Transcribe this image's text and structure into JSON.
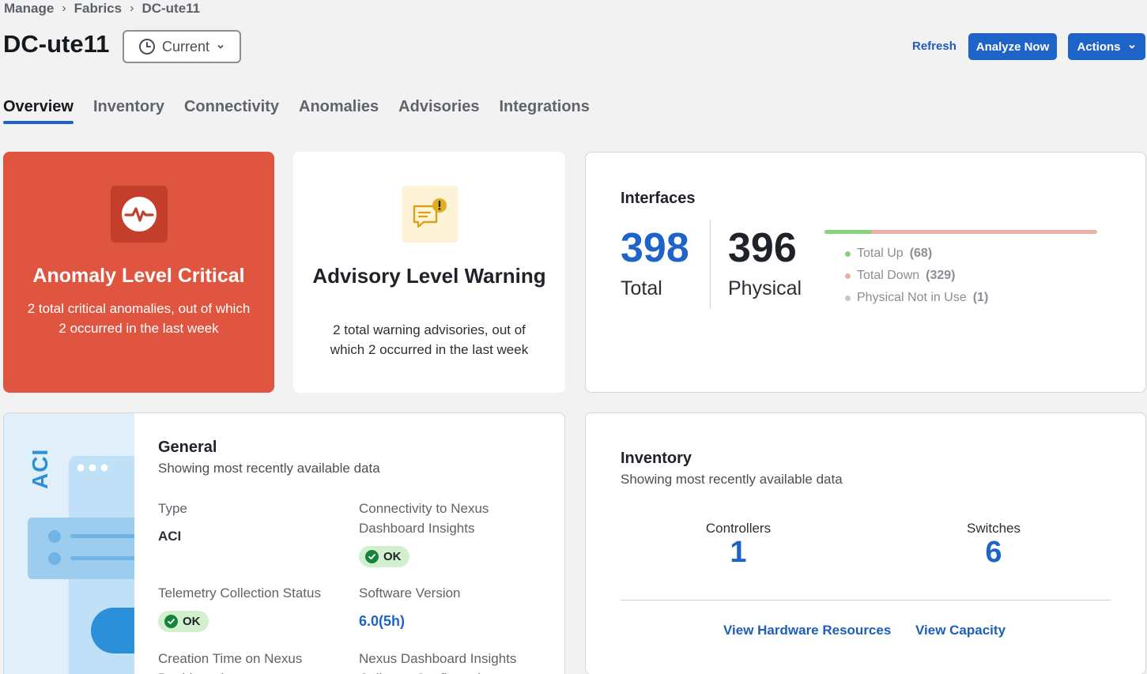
{
  "breadcrumb": {
    "items": [
      "Manage",
      "Fabrics",
      "DC-ute11"
    ]
  },
  "header": {
    "title": "DC-ute11",
    "time_selector": "Current",
    "refresh_label": "Refresh",
    "analyze_label": "Analyze Now",
    "actions_label": "Actions"
  },
  "tabs": [
    "Overview",
    "Inventory",
    "Connectivity",
    "Anomalies",
    "Advisories",
    "Integrations"
  ],
  "anomaly_card": {
    "title": "Anomaly Level Critical",
    "description": "2 total critical anomalies, out of which 2 occurred in the last week",
    "icon": "pulse-icon"
  },
  "advisory_card": {
    "title": "Advisory Level Warning",
    "description": "2 total warning advisories, out of which 2 occurred in the last week",
    "icon": "chat-alert-icon"
  },
  "interfaces": {
    "title": "Interfaces",
    "total_value": "398",
    "total_label": "Total",
    "physical_value": "396",
    "physical_label": "Physical",
    "up_fraction": 0.17,
    "legend": [
      {
        "label": "Total Up",
        "count": "(68)",
        "color": "#88d27a"
      },
      {
        "label": "Total Down",
        "count": "(329)",
        "color": "#eab0a8"
      },
      {
        "label": "Physical Not in Use",
        "count": "(1)",
        "color": "#c4c6c9"
      }
    ]
  },
  "general": {
    "art_label": "ACI",
    "title": "General",
    "subtitle": "Showing most recently available data",
    "type_label": "Type",
    "type_value": "ACI",
    "connectivity_label": "Connectivity to Nexus Dashboard Insights",
    "connectivity_status": "OK",
    "telemetry_label": "Telemetry Collection Status",
    "telemetry_status": "OK",
    "version_label": "Software Version",
    "version_value": "6.0(5h)",
    "creation_label": "Creation Time on Nexus Dashboard",
    "collector_label": "Nexus Dashboard Insights Collector Configuration"
  },
  "inventory": {
    "title": "Inventory",
    "subtitle": "Showing most recently available data",
    "controllers_label": "Controllers",
    "controllers_value": "1",
    "switches_label": "Switches",
    "switches_value": "6",
    "hardware_link": "View Hardware Resources",
    "capacity_link": "View Capacity"
  },
  "colors": {
    "accent": "#1e63c7",
    "critical": "#e0553f",
    "warning_bg": "#fdf3d6",
    "ok_bg": "#d2efce"
  }
}
